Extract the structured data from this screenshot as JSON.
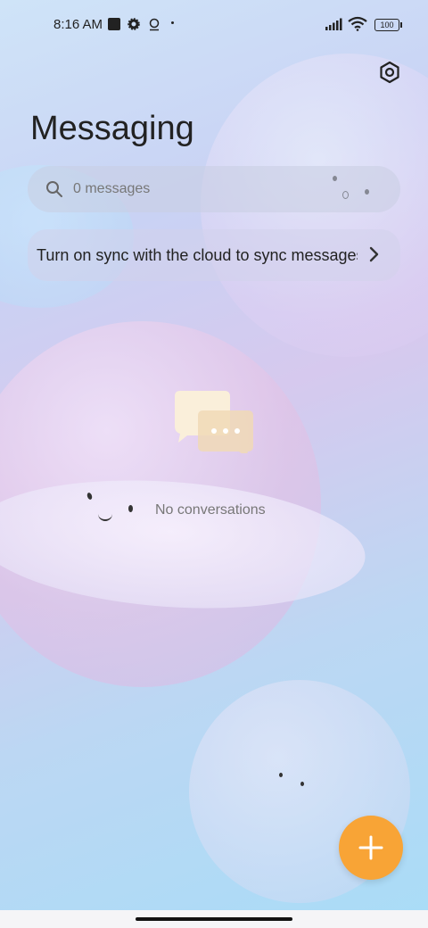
{
  "status_bar": {
    "time": "8:16 AM",
    "battery": "100",
    "icons": [
      "square-icon",
      "gear-icon",
      "location-icon",
      "dot-icon",
      "signal-icon",
      "wifi-icon",
      "battery-icon"
    ]
  },
  "header": {
    "title": "Messaging",
    "settings_icon": "settings-hexagon-icon"
  },
  "search": {
    "placeholder": "0 messages",
    "icon": "search-icon"
  },
  "sync_banner": {
    "text": "Turn on sync with the cloud to sync messages",
    "icon": "chevron-right-icon"
  },
  "empty_state": {
    "icon": "chat-bubbles-icon",
    "text": "No conversations"
  },
  "fab": {
    "icon": "plus-icon",
    "color": "#f8a436"
  },
  "colors": {
    "accent": "#f8a436",
    "text_primary": "#222222",
    "text_secondary": "#777777"
  }
}
